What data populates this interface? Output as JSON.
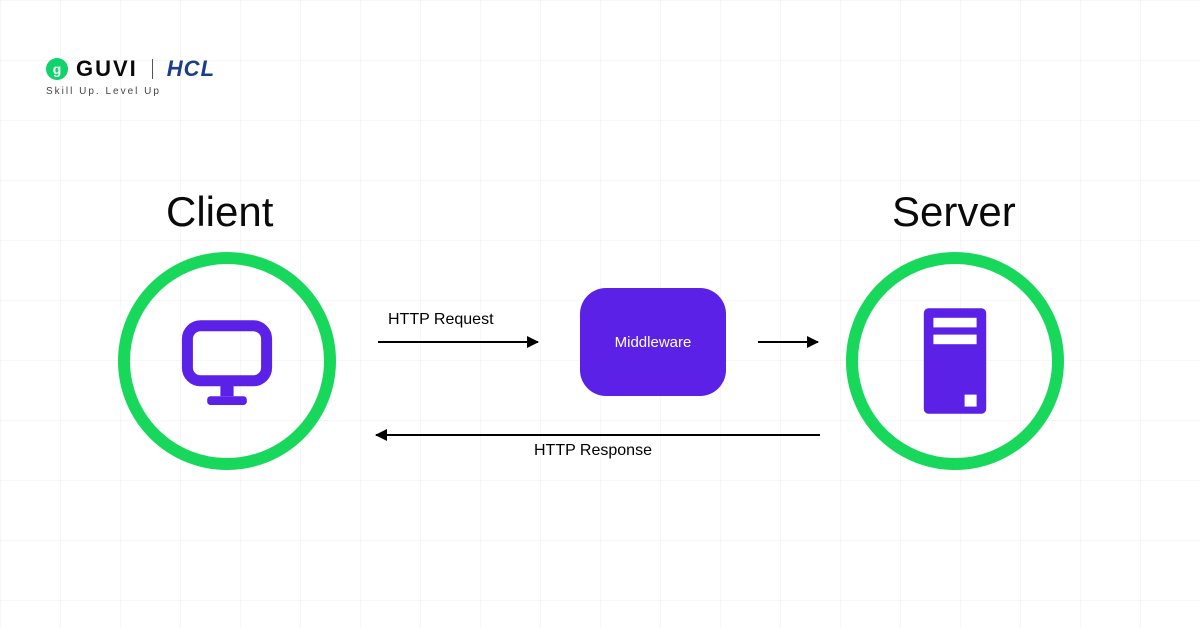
{
  "logo": {
    "brand1": "GUVI",
    "brand1_badge": "g",
    "brand2": "HCL",
    "tagline": "Skill Up. Level Up"
  },
  "nodes": {
    "client_label": "Client",
    "server_label": "Server",
    "middleware_label": "Middleware"
  },
  "arrows": {
    "request_label": "HTTP Request",
    "response_label": "HTTP Response"
  },
  "colors": {
    "circle_border": "#17d85a",
    "middleware_bg": "#5b21e6",
    "icon_purple": "#5b21e6",
    "brand1_green": "#0fd46c",
    "brand2_blue": "#1a3e8c"
  },
  "chart_data": {
    "type": "diagram",
    "title": "Client–Middleware–Server HTTP flow",
    "nodes": [
      {
        "id": "client",
        "label": "Client",
        "shape": "circle",
        "icon": "monitor"
      },
      {
        "id": "middleware",
        "label": "Middleware",
        "shape": "rounded-rect"
      },
      {
        "id": "server",
        "label": "Server",
        "shape": "circle",
        "icon": "server-tower"
      }
    ],
    "edges": [
      {
        "from": "client",
        "to": "middleware",
        "label": "HTTP Request",
        "direction": "right"
      },
      {
        "from": "middleware",
        "to": "server",
        "label": "",
        "direction": "right"
      },
      {
        "from": "server",
        "to": "client",
        "label": "HTTP Response",
        "direction": "left"
      }
    ]
  }
}
